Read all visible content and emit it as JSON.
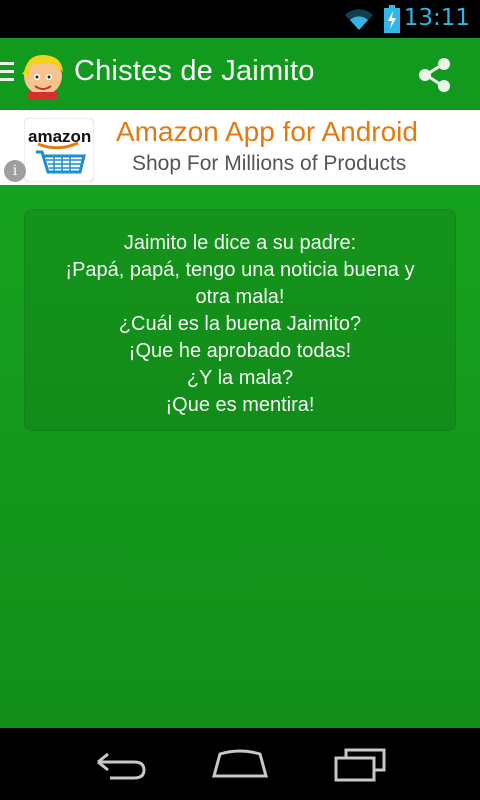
{
  "status_bar": {
    "time": "13:11",
    "icons": [
      "wifi-icon",
      "battery-charging-icon"
    ]
  },
  "action_bar": {
    "title": "Chistes de Jaimito",
    "icons": [
      "drawer-menu-icon",
      "app-logo-icon",
      "share-icon"
    ],
    "background": "#129a1f"
  },
  "ad_banner": {
    "logo_text": "amazon",
    "headline": "Amazon App for Android",
    "subline": "Shop For Millions of Products",
    "accent_color": "#e47911",
    "icons": [
      "amazon-cart-icon",
      "info-icon"
    ]
  },
  "joke": {
    "lines": [
      "Jaimito le dice a su padre:",
      "¡Papá, papá, tengo una noticia buena y",
      "otra mala!",
      "¿Cuál es la buena Jaimito?",
      "¡Que he aprobado todas!",
      "¿Y la mala?",
      "¡Que es mentira!"
    ]
  },
  "navigation_bar": {
    "icons": [
      "back-icon",
      "home-icon",
      "recent-apps-icon"
    ]
  },
  "colors": {
    "primary_green": "#129a1f",
    "content_green": "#16a11f",
    "status_blue": "#33b5e5"
  }
}
